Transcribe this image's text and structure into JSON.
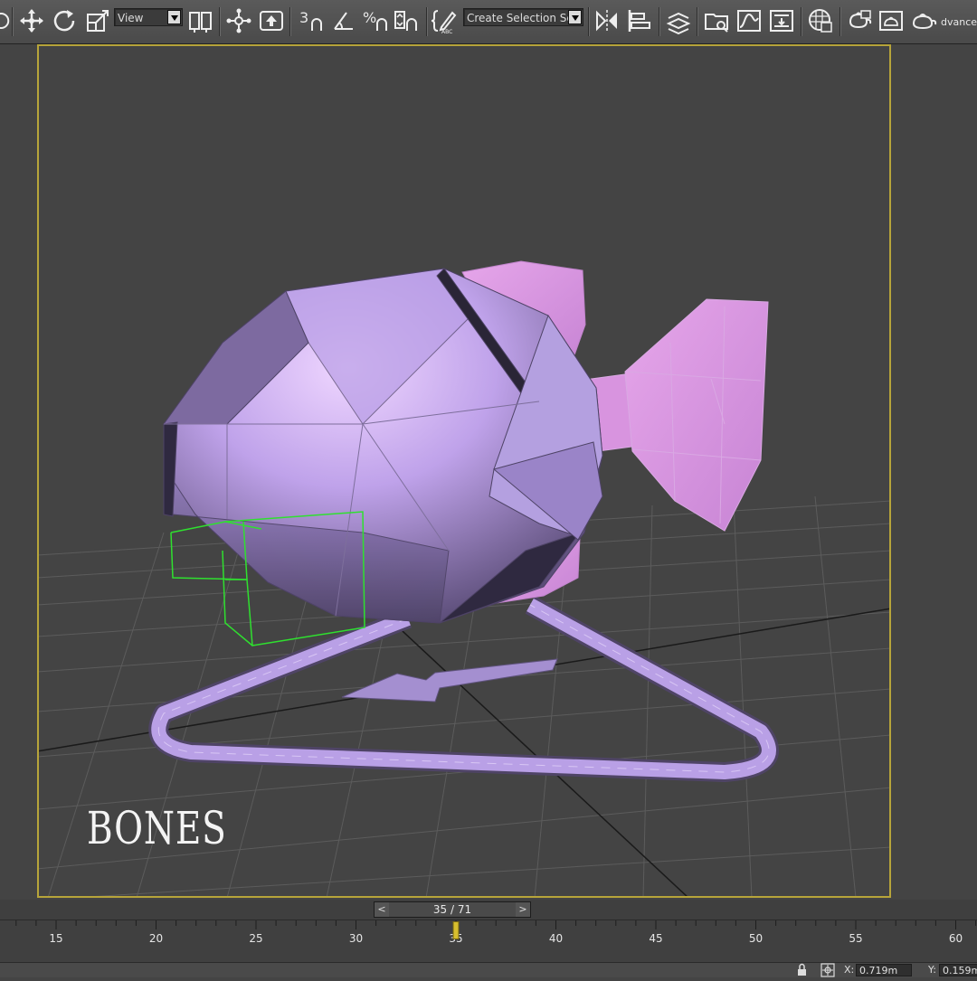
{
  "toolbar": {
    "view_dropdown": "View",
    "selection_set_dropdown": "Create Selection Se",
    "angle_snap_label": "3",
    "percent_snap_label": "%",
    "advanced_label": "dvanced"
  },
  "overlay": {
    "watermark": "BONES"
  },
  "timeline": {
    "frame_counter": "35 / 71",
    "prev_label": "<",
    "next_label": ">",
    "current_frame": 35,
    "ticks": [
      15,
      20,
      25,
      30,
      35,
      40,
      45,
      50,
      55,
      60
    ]
  },
  "status": {
    "x_label": "X:",
    "x_value": "0.719m",
    "y_label": "Y:",
    "y_value": "0.159m"
  },
  "colors": {
    "viewport_background": "#444444",
    "viewport_border": "#b7a43a",
    "fish_body": "#b9a0e6",
    "fish_fins": "#dc9ee0",
    "helper_box": "#2fe02f",
    "grid": "#555555"
  },
  "icons": [
    "undo-icon",
    "move-icon",
    "rotate-icon",
    "scale-icon",
    "select-and-place-icon",
    "pivot-icon",
    "manipulate-icon",
    "angle-snap-icon",
    "percent-snap-icon",
    "spinner-snap-icon",
    "edit-named-selection-icon",
    "mirror-icon",
    "align-icon",
    "layer-manager-icon",
    "scene-explorer-icon",
    "curve-editor-icon",
    "schematic-view-icon",
    "material-editor-icon",
    "render-setup-icon",
    "rendered-frame-window-icon",
    "render-icon",
    "lock-icon",
    "absolute-mode-icon"
  ]
}
